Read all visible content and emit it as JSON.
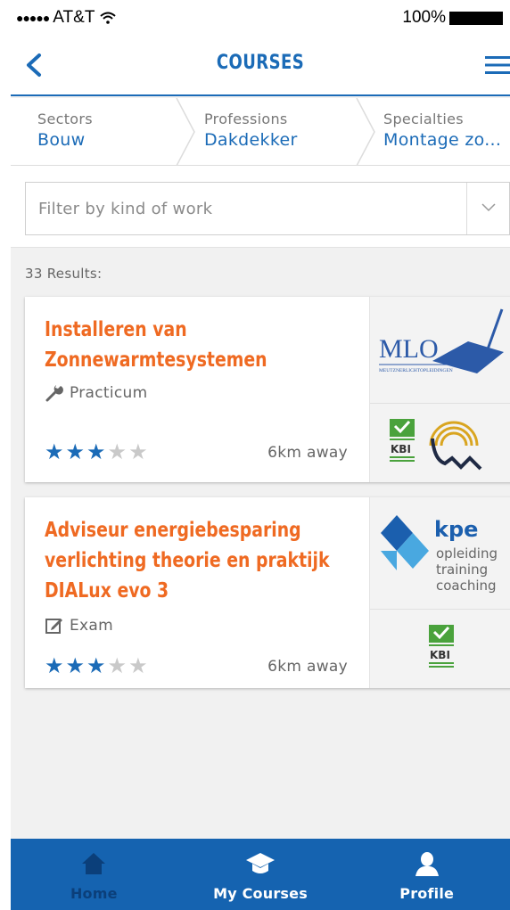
{
  "status_bar": {
    "carrier": "AT&T",
    "signal_dots": "●●●●●",
    "battery": "100%"
  },
  "nav": {
    "title": "COURSES",
    "back_icon": "chevron-left-icon",
    "menu_icon": "hamburger-icon"
  },
  "breadcrumb": [
    {
      "label": "Sectors",
      "value": "Bouw"
    },
    {
      "label": "Professions",
      "value": "Dakdekker"
    },
    {
      "label": "Specialties",
      "value": "Montage zo..."
    }
  ],
  "filter": {
    "placeholder": "Filter by kind of work"
  },
  "results_label": "33 Results:",
  "courses": [
    {
      "title_lines": [
        "Installeren van",
        "Zonnewarmtesystemen"
      ],
      "kind": "Practicum",
      "kind_icon": "wrench-icon",
      "rating": 3,
      "rating_max": 5,
      "distance": "6km away",
      "provider_logo": {
        "text": "MLO",
        "subtext": "MEUTZNERLICHTOPLEIDINGEN"
      },
      "badges": {
        "kbi_text": "KBI"
      }
    },
    {
      "title_lines": [
        "Adviseur energiebesparing",
        "verlichting theorie en praktijk",
        "DIALux evo 3"
      ],
      "kind": "Exam",
      "kind_icon": "edit-icon",
      "rating": 3,
      "rating_max": 5,
      "distance": "6km away",
      "provider_logo": {
        "text": "kpe",
        "lines": [
          "opleiding",
          "training",
          "coaching"
        ]
      },
      "badges": {
        "kbi_text": "KBI"
      }
    }
  ],
  "tabs": [
    {
      "label": "Home",
      "icon": "home-icon",
      "active": true
    },
    {
      "label": "My Courses",
      "icon": "graduation-cap-icon",
      "active": false
    },
    {
      "label": "Profile",
      "icon": "person-icon",
      "active": false
    }
  ],
  "colors": {
    "brand_blue": "#1b6bb7",
    "accent_orange": "#ef6a22",
    "tabbar_blue": "#1563b0"
  }
}
